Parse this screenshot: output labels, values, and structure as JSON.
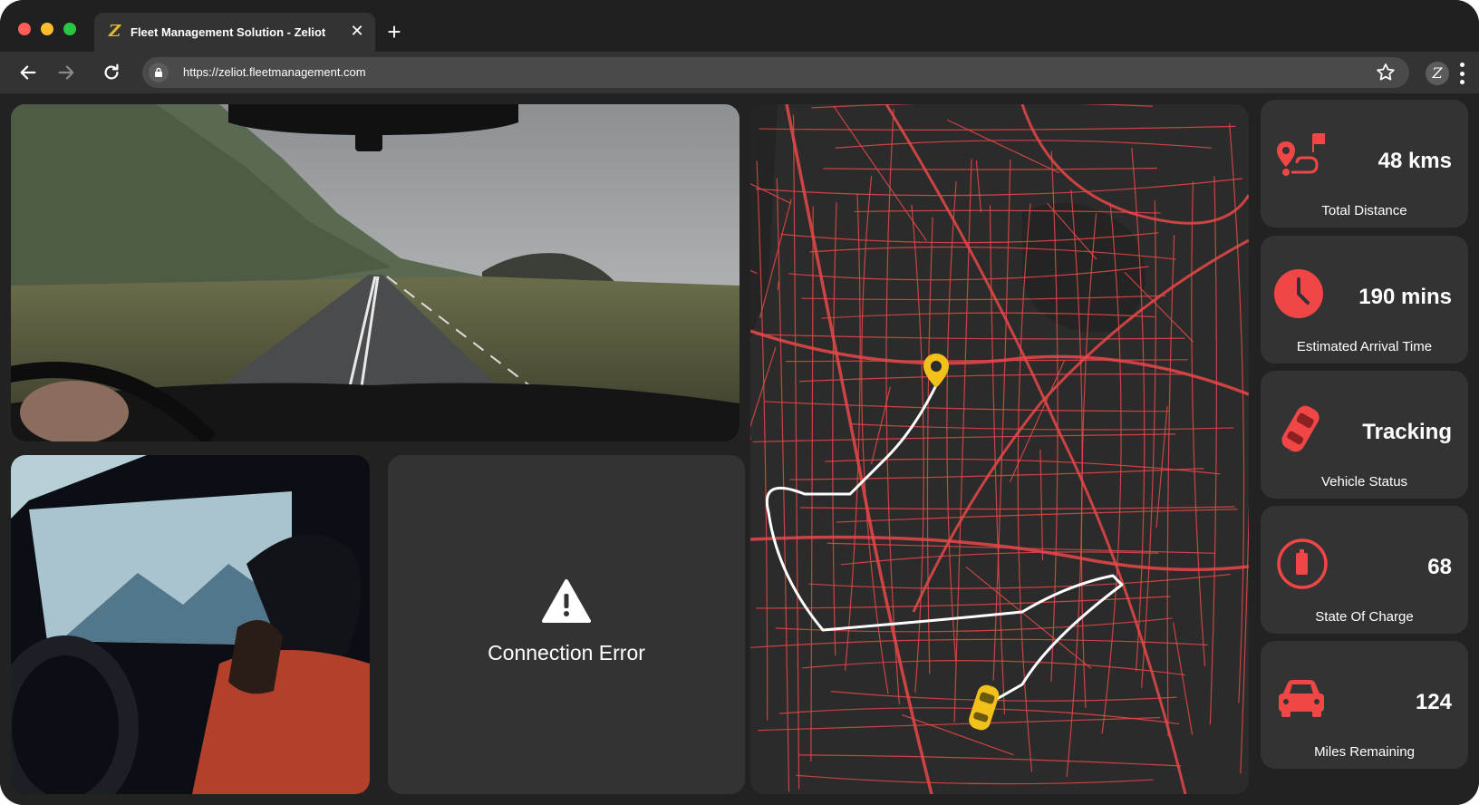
{
  "browser": {
    "tab": {
      "logo": "Z",
      "title": "Fleet Management Solution - Zeliot",
      "close_icon": "close-icon"
    },
    "new_tab_icon": "plus-icon",
    "toolbar": {
      "back_icon": "arrow-left-icon",
      "forward_icon": "arrow-right-icon",
      "reload_icon": "reload-icon",
      "url": "https://zeliot.fleetmanagement.com",
      "lock_icon": "lock-icon",
      "bookmark_icon": "star-icon",
      "profile": "Z",
      "menu_icon": "kebab-icon"
    },
    "traffic_lights": [
      "#ff5f57",
      "#febc2e",
      "#28c840"
    ]
  },
  "dashboard": {
    "error": {
      "icon": "warning-icon",
      "message": "Connection Error"
    },
    "map": {
      "route_color": "#ffffff",
      "road_color": "#e84848",
      "pin_color": "#f2c21b",
      "vehicle_color": "#f2c21b"
    },
    "stats": [
      {
        "icon": "route-icon",
        "value": "48 kms",
        "label": "Total Distance"
      },
      {
        "icon": "clock-icon",
        "value": "190 mins",
        "label": "Estimated Arrival Time"
      },
      {
        "icon": "car-top-icon",
        "value": "Tracking",
        "label": "Vehicle Status"
      },
      {
        "icon": "battery-icon",
        "value": "68",
        "label": "State Of Charge"
      },
      {
        "icon": "car-front-icon",
        "value": "124",
        "label": "Miles Remaining"
      }
    ],
    "accent": "#f04646"
  }
}
